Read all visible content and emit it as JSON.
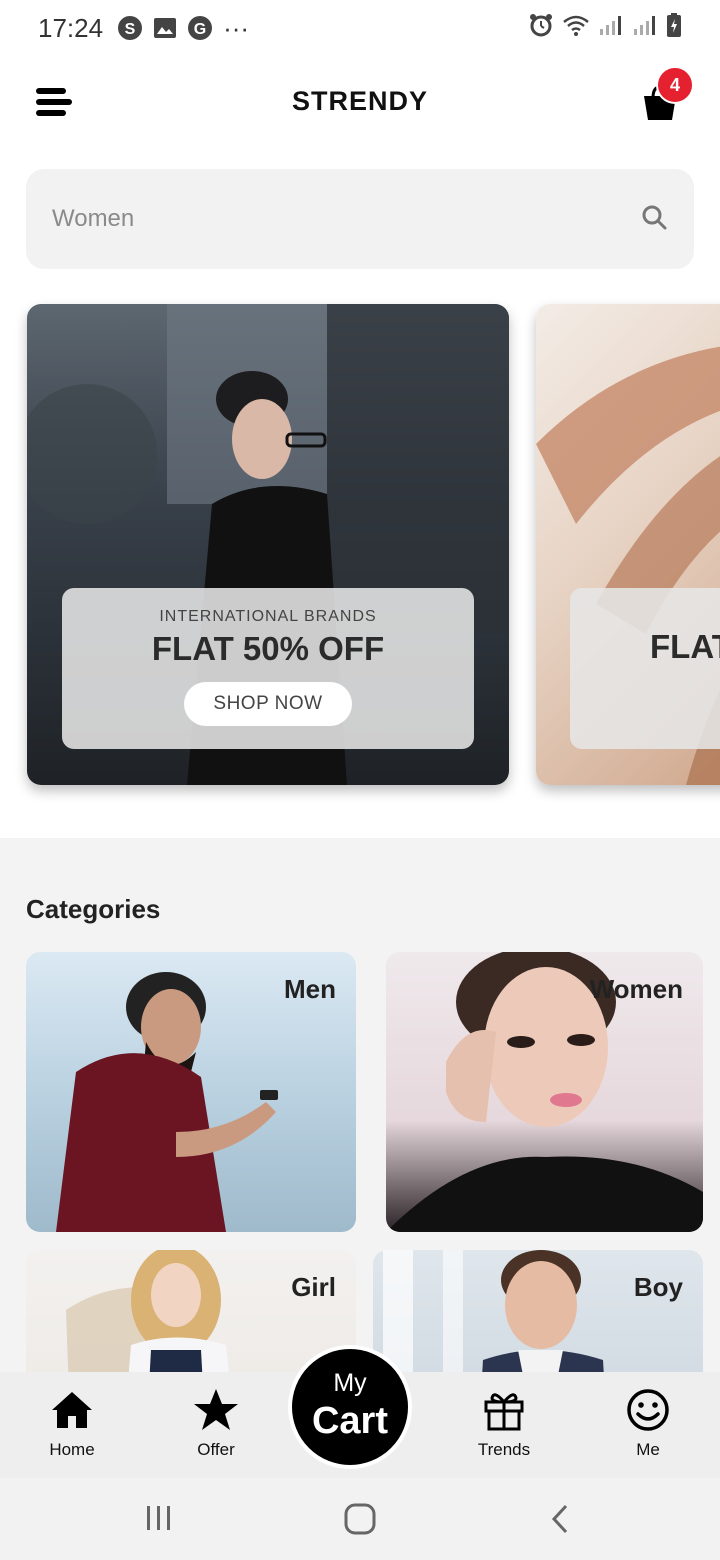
{
  "status_bar": {
    "time": "17:24",
    "more": "···"
  },
  "header": {
    "title": "STRENDY",
    "cart_count": "4"
  },
  "search": {
    "placeholder": "Women"
  },
  "banners": [
    {
      "subtitle": "INTERNATIONAL BRANDS",
      "headline": "FLAT 50% OFF",
      "button": "SHOP NOW"
    },
    {
      "subtitle": "",
      "headline": "FLAT",
      "button": ""
    }
  ],
  "categories": {
    "title": "Categories",
    "items": [
      {
        "label": "Men"
      },
      {
        "label": "Women"
      },
      {
        "label": "Girl"
      },
      {
        "label": "Boy"
      }
    ]
  },
  "bottom_nav": {
    "items": [
      {
        "label": "Home",
        "icon": "home-icon"
      },
      {
        "label": "Offer",
        "icon": "star-icon"
      },
      {
        "label": "Trends",
        "icon": "gift-icon"
      },
      {
        "label": "Me",
        "icon": "smiley-icon"
      }
    ],
    "cart_fab": {
      "line1": "My",
      "line2": "Cart"
    }
  },
  "colors": {
    "badge": "#e5202f",
    "fab": "#000000",
    "nav_bg": "#eeeeee",
    "search_bg": "#f2f2f2"
  }
}
